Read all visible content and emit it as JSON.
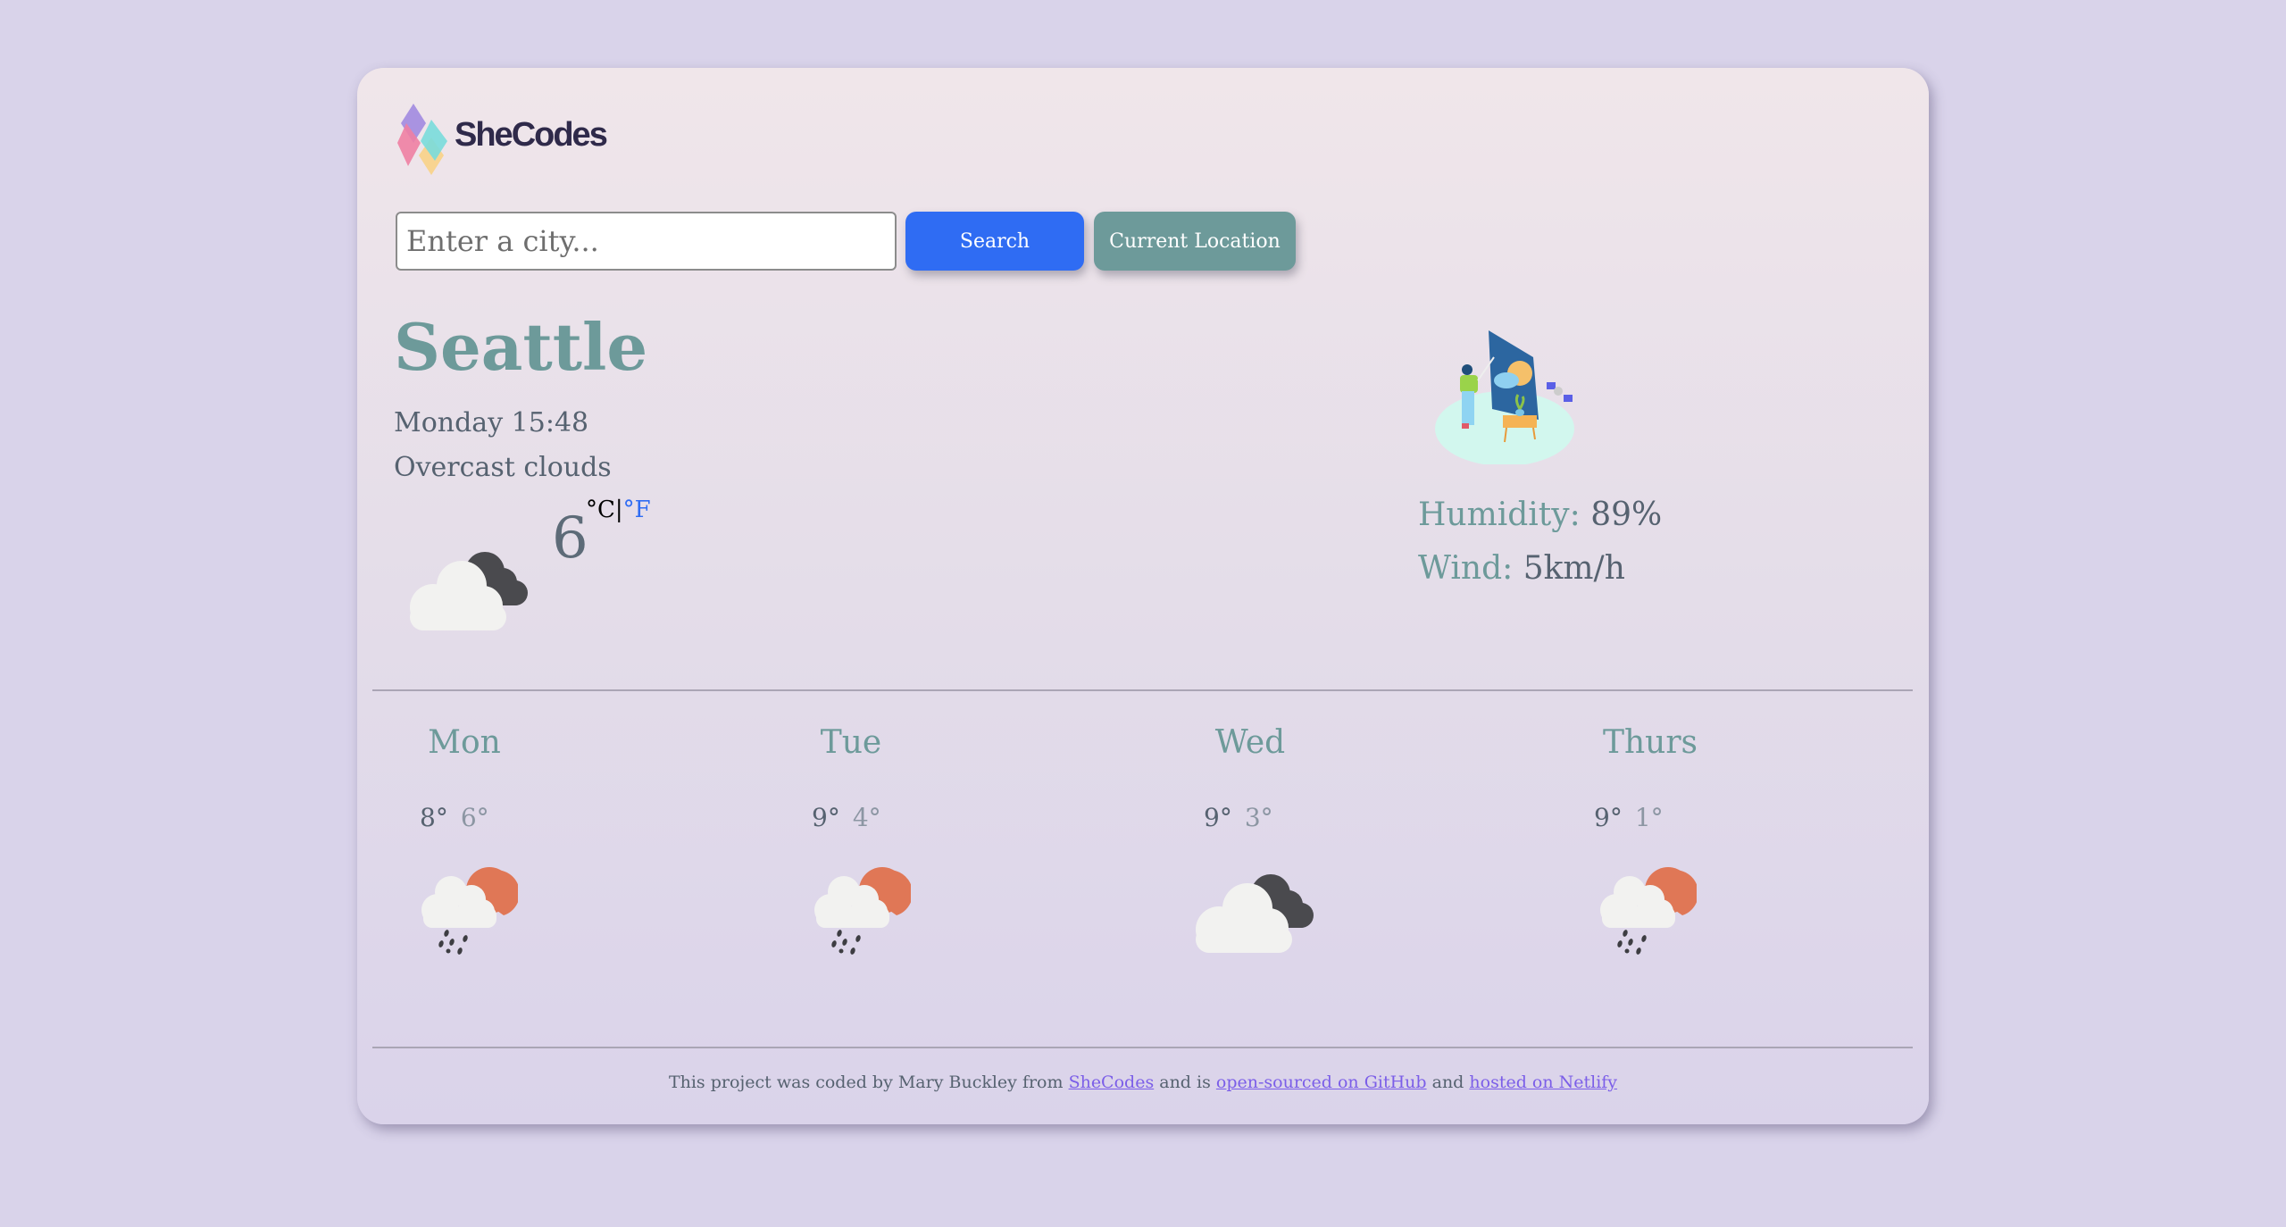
{
  "brand": {
    "logo_text": "SheCodes"
  },
  "search": {
    "placeholder": "Enter a city...",
    "value": "",
    "search_label": "Search",
    "location_label": "Current Location"
  },
  "current": {
    "city": "Seattle",
    "datetime": "Monday 15:48",
    "description": "Overcast clouds",
    "icon": "overcast-clouds-icon",
    "temperature": "6",
    "unit_celsius": "°C",
    "unit_separator": "|",
    "unit_fahrenheit": "°F",
    "humidity_label": "Humidity:",
    "humidity_value": "89%",
    "wind_label": "Wind:",
    "wind_value": "5km/h",
    "illustration": "weather-presenter-illustration"
  },
  "forecast": [
    {
      "day": "Mon",
      "max": "8°",
      "min": "6°",
      "icon": "rain-sun-icon"
    },
    {
      "day": "Tue",
      "max": "9°",
      "min": "4°",
      "icon": "rain-sun-icon"
    },
    {
      "day": "Wed",
      "max": "9°",
      "min": "3°",
      "icon": "overcast-clouds-icon"
    },
    {
      "day": "Thurs",
      "max": "9°",
      "min": "1°",
      "icon": "rain-sun-icon"
    }
  ],
  "footer": {
    "text_1": "This project was coded by Mary Buckley from ",
    "link_1": "SheCodes",
    "text_2": " and is ",
    "link_2": "open-sourced on GitHub",
    "text_3": " and ",
    "link_3": "hosted on Netlify"
  },
  "colors": {
    "accent_teal": "#6d9a9a",
    "primary_blue": "#2f6cf3",
    "text_slate": "#566270",
    "link_purple": "#7b5ee8",
    "background": "#d9d3ea"
  }
}
